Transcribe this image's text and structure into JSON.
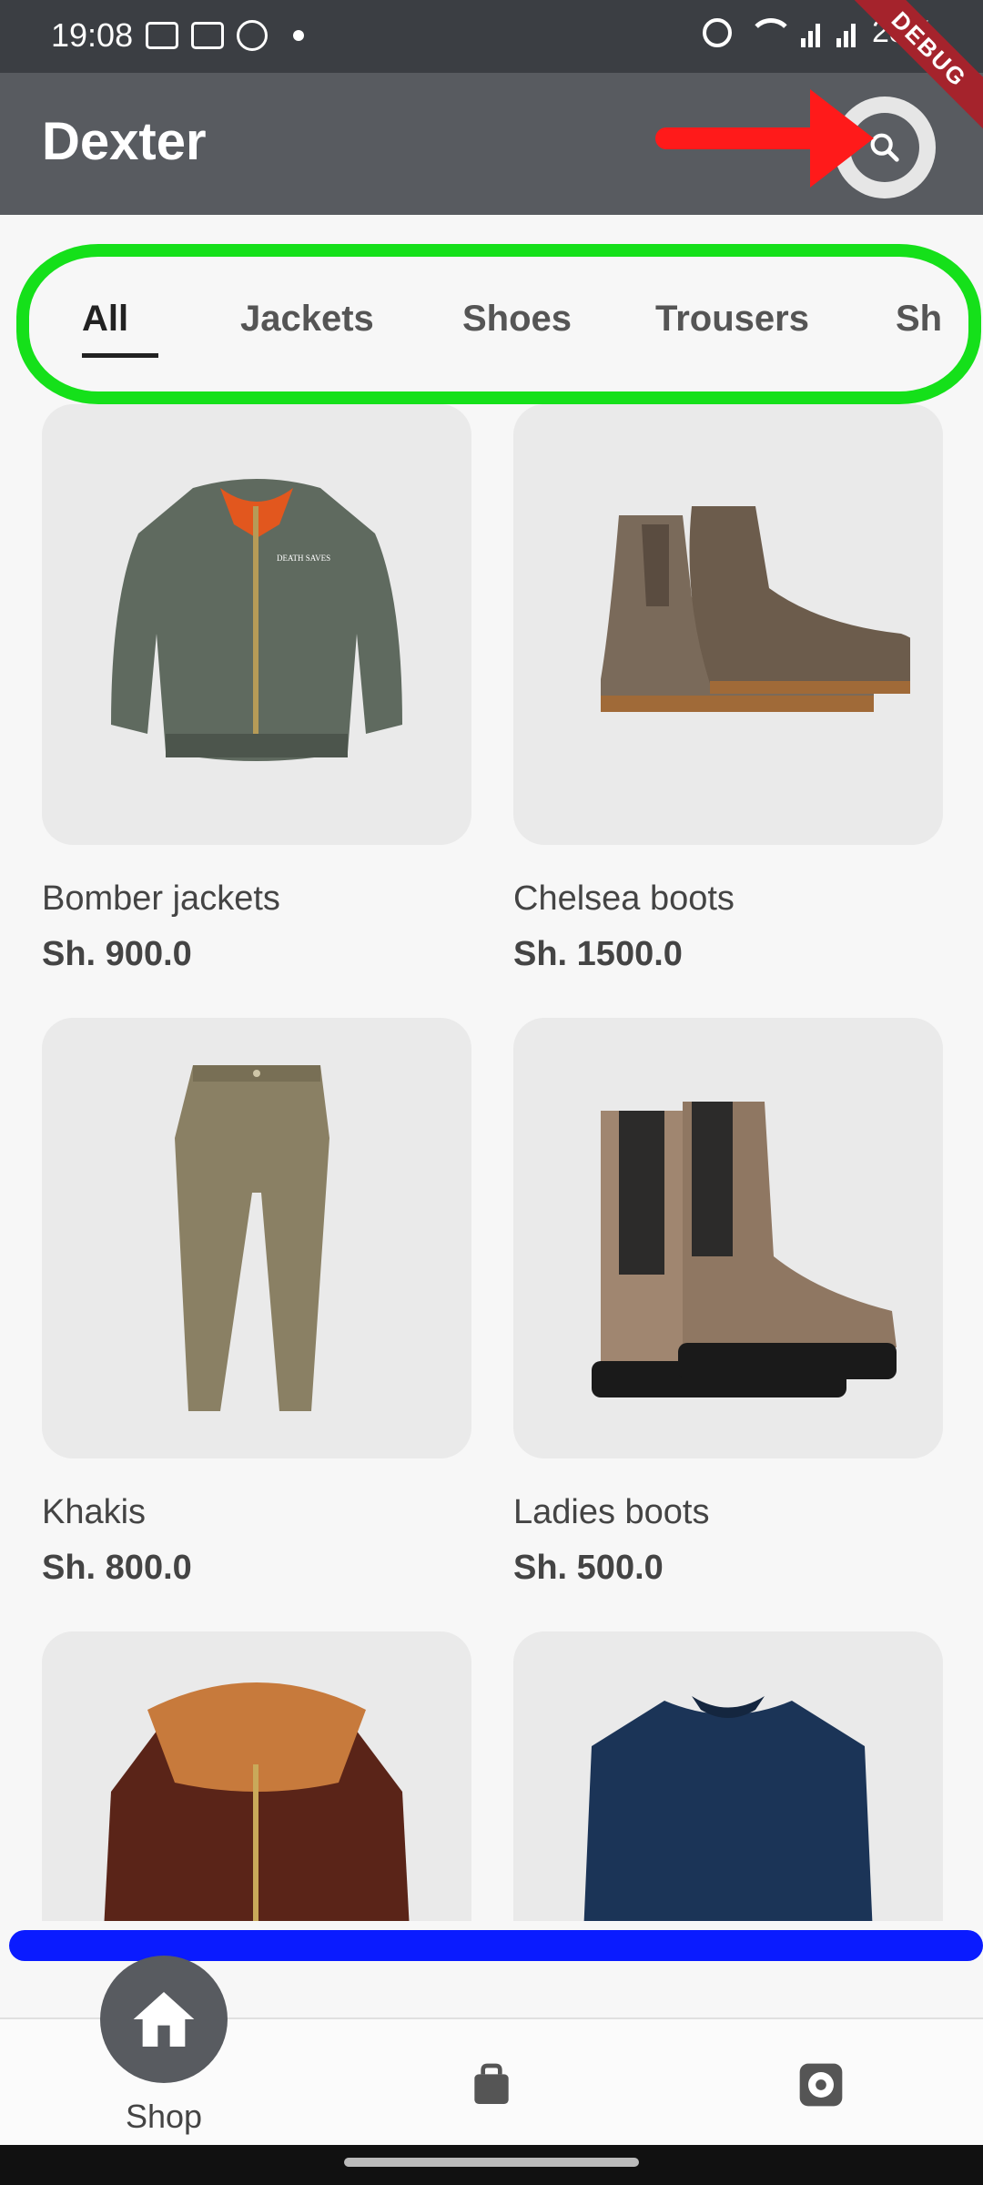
{
  "status_bar": {
    "time": "19:08",
    "battery": "28%"
  },
  "debug_label": "DEBUG",
  "app_bar": {
    "title": "Dexter",
    "search_icon": "search-icon"
  },
  "tabs": [
    "All",
    "Jackets",
    "Shoes",
    "Trousers",
    "Sh"
  ],
  "products": [
    {
      "name": "Bomber jackets",
      "price": "Sh. 900.0",
      "print": "DEATH SAVES"
    },
    {
      "name": "Chelsea boots",
      "price": "Sh. 1500.0"
    },
    {
      "name": "Khakis",
      "price": "Sh. 800.0"
    },
    {
      "name": "Ladies boots",
      "price": "Sh. 500.0"
    },
    {
      "name": "",
      "price": ""
    },
    {
      "name": "",
      "price": ""
    }
  ],
  "bottom_nav": {
    "shop_label": "Shop"
  },
  "colors": {
    "appbar": "#585b60",
    "statusbar": "#3b3e43",
    "background": "#f7f7f7",
    "card": "#eaeaea"
  }
}
